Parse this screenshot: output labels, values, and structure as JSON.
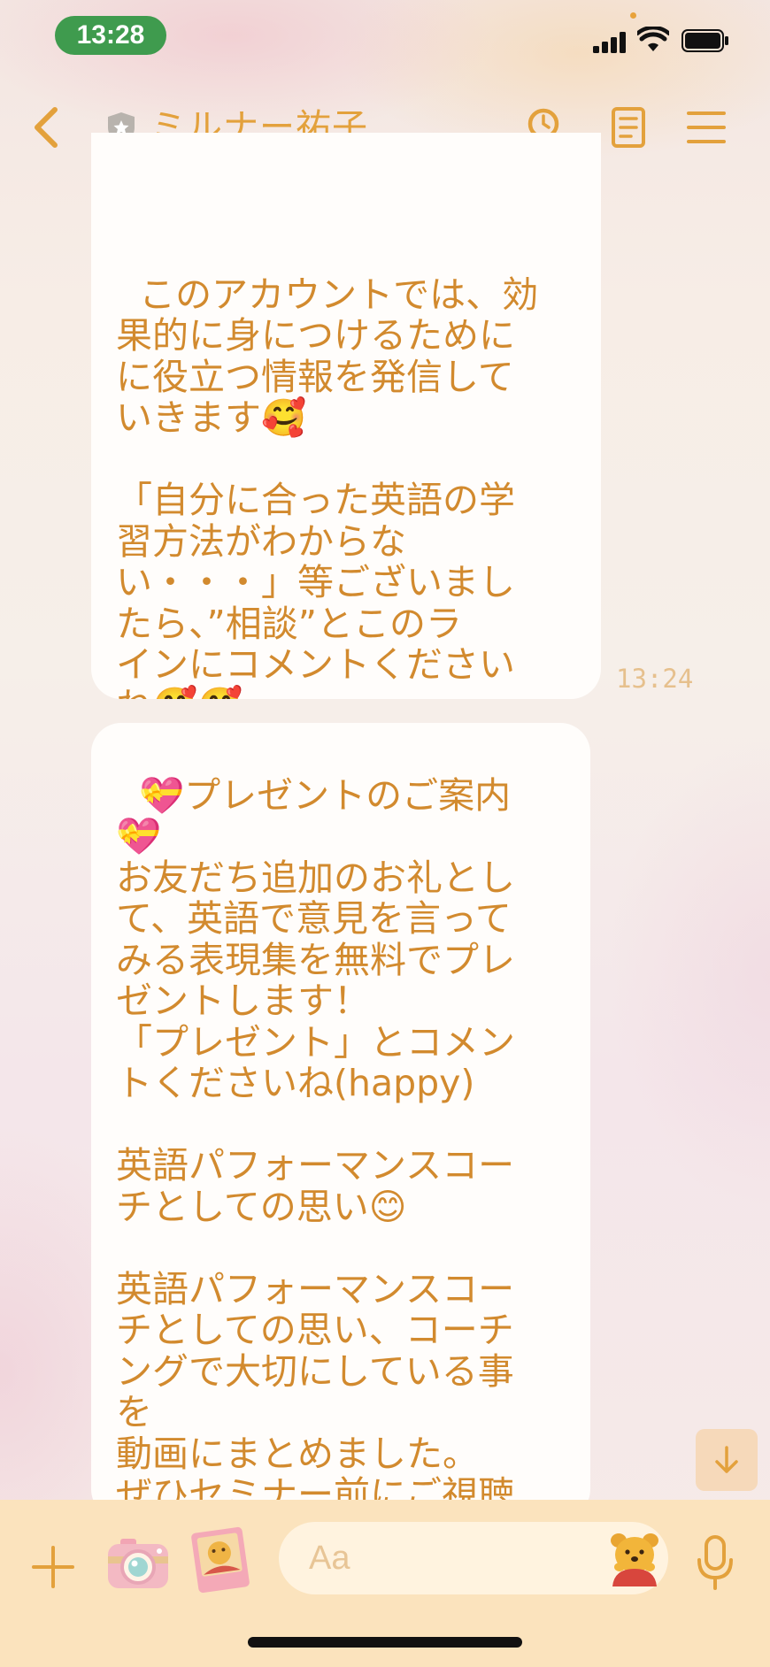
{
  "status_bar": {
    "time": "13:28"
  },
  "header": {
    "title": "ミルナー祐子",
    "icons": [
      "back-chevron-icon",
      "shield-icon",
      "search-icon",
      "notes-icon",
      "menu-icon"
    ]
  },
  "messages": [
    {
      "text": "このアカウントでは、効\n果的に身につけるために\nに役立つ情報を発信して\nいきます🥰\n\n「自分に合った英語の学\n習方法がわからな\nい・・・」等ございまし\nたら、”相談”とこのラ\nインにコメントください\nね🥰🥰",
      "time": "13:24"
    },
    {
      "text": "💝プレゼントのご案内\n💝\nお友だち追加のお礼とし\nて、英語で意見を言って\nみる表現集を無料でプレ\nゼントします！\n「プレゼント」とコメン\nトくださいね(happy)\n\n英語パフォーマンスコー\nチとしての思い😊\n\n英語パフォーマンスコー\nチとしての思い、コーチ\nングで大切にしている事\nを\n動画にまとめました。\nぜひセミナー前にご視聴\n頂けると嬉しいです。"
    }
  ],
  "input_bar": {
    "placeholder": "Aa"
  },
  "colors": {
    "accent": "#e3a13c",
    "text": "#d28a2e",
    "input_bar": "#fbe3bd",
    "time_pill": "#3f9b4e"
  }
}
